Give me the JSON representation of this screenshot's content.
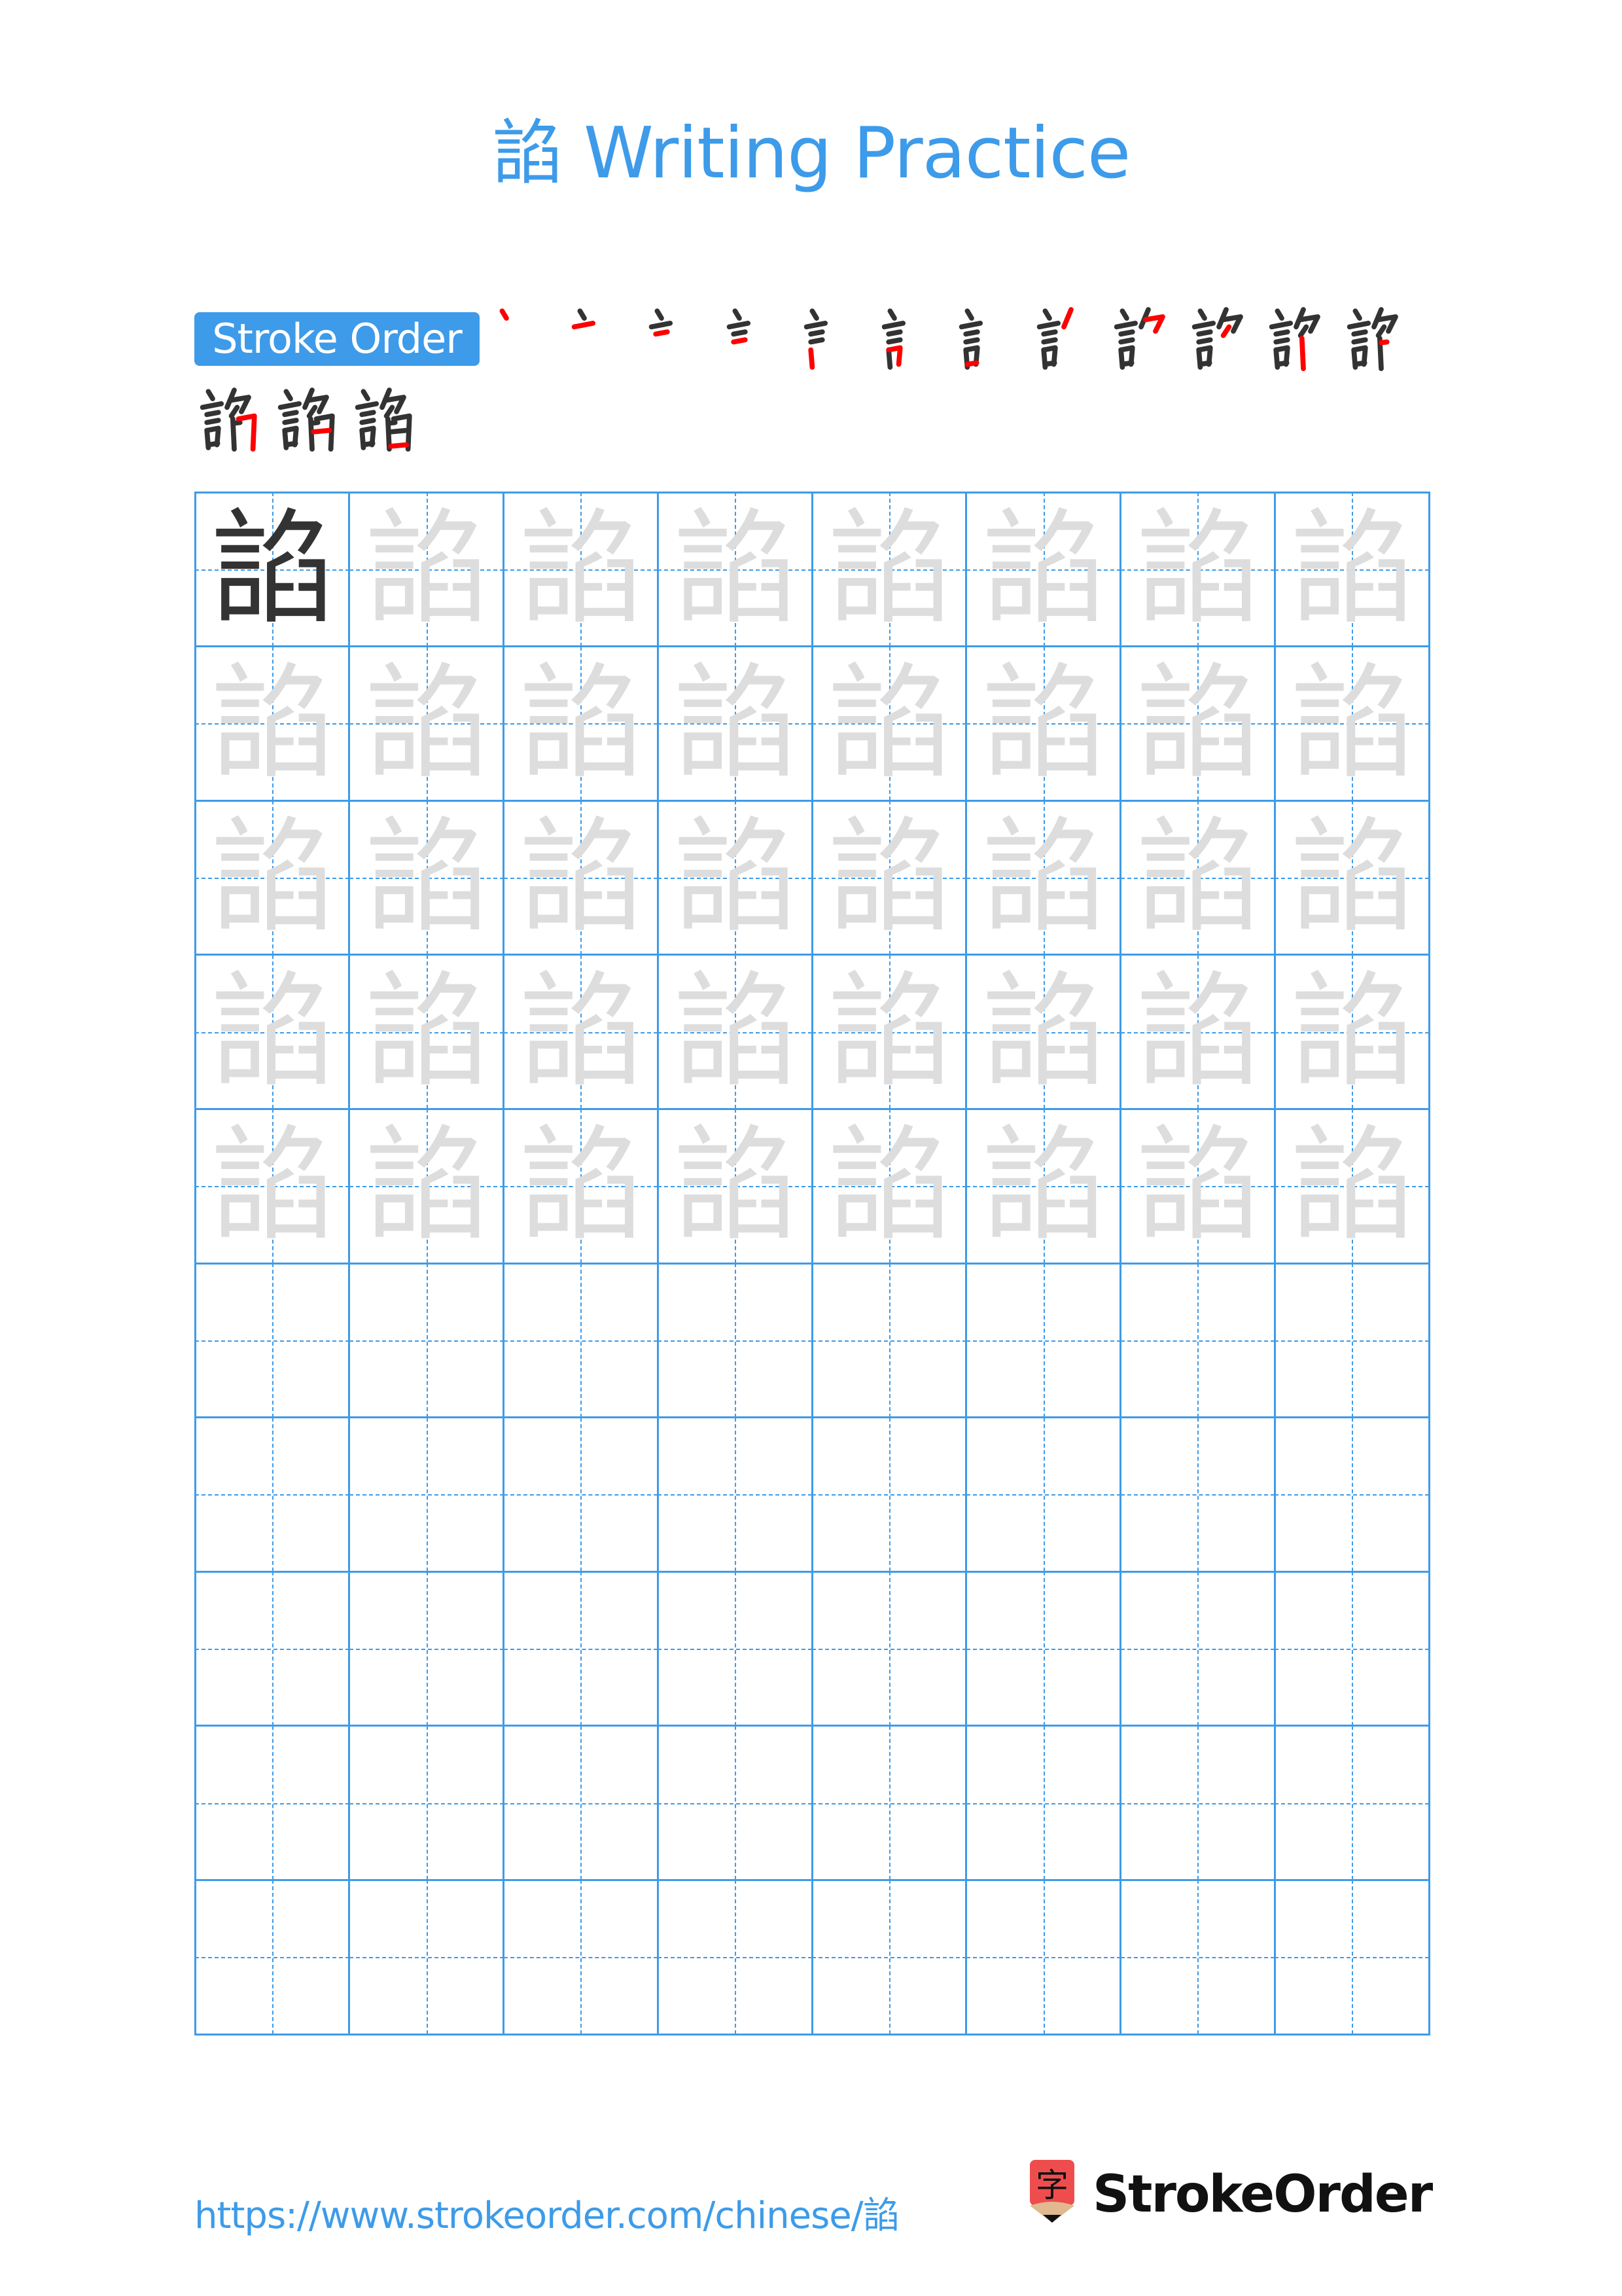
{
  "title": "諂 Writing Practice",
  "character": "諂",
  "stroke_order": {
    "label": "Stroke Order",
    "total_strokes": 15,
    "highlight_color": "#ff0000",
    "ink_color": "#333333"
  },
  "grid": {
    "columns": 8,
    "rows": 10,
    "traced_rows": 5,
    "line_color": "#3d9be9",
    "model_char_color": "#333333",
    "trace_char_color": "#dddddd"
  },
  "footer": {
    "url": "https://www.strokeorder.com/chinese/諂",
    "brand": "StrokeOrder",
    "logo_glyph": "字",
    "logo_color": "#ef4d4d"
  }
}
